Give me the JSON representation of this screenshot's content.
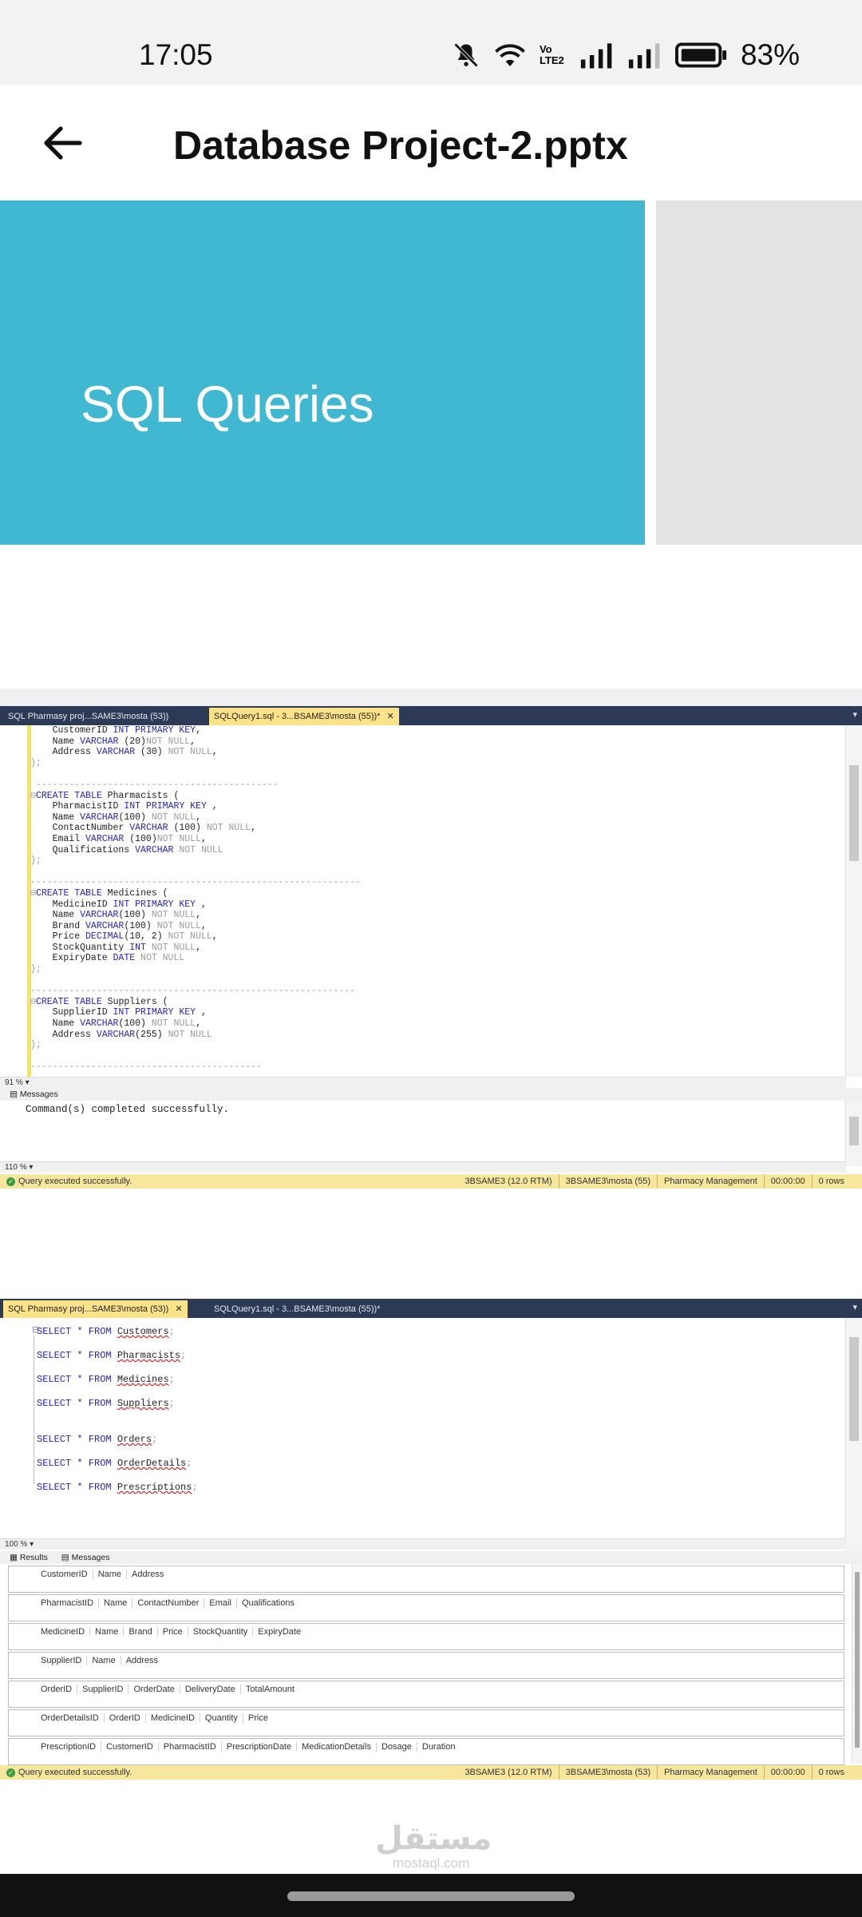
{
  "status_bar": {
    "time": "17:05",
    "volte": "Vo LTE2",
    "battery_percent": "83%"
  },
  "app_bar": {
    "title": "Database Project-2.pptx"
  },
  "slide1": {
    "title": "SQL Queries"
  },
  "ssms1": {
    "tab_inactive": "SQL Pharmasy proj...SAME3\\mosta (53))",
    "tab_active": "SQLQuery1.sql - 3...BSAME3\\mosta (55))*",
    "editor_zoom": "91 %",
    "messages_tab": "Messages",
    "message": "Command(s) completed successfully.",
    "messages_zoom": "110 %",
    "status_text": "Query executed successfully.",
    "status_server": "3BSAME3 (12.0 RTM)",
    "status_user": "3BSAME3\\mosta (55)",
    "status_db": "Pharmacy Management",
    "status_time": "00:00:00",
    "status_rows": "0 rows"
  },
  "ssms2": {
    "tab_active": "SQL Pharmasy proj...SAME3\\mosta (53))",
    "tab_inactive": "SQLQuery1.sql - 3...BSAME3\\mosta (55))*",
    "editor_zoom": "100 %",
    "results_tab": "Results",
    "messages_tab": "Messages",
    "queries": [
      {
        "kw": "SELECT * FROM",
        "table": "Customers"
      },
      {
        "kw": "SELECT * FROM",
        "table": "Pharmacists"
      },
      {
        "kw": "SELECT * FROM",
        "table": "Medicines"
      },
      {
        "kw": "SELECT * FROM",
        "table": "Suppliers"
      },
      {
        "kw": "SELECT * FROM",
        "table": "Orders"
      },
      {
        "kw": "SELECT * FROM",
        "table": "OrderDetails"
      },
      {
        "kw": "SELECT * FROM",
        "table": "Prescriptions"
      }
    ],
    "result_grids": [
      [
        "CustomerID",
        "Name",
        "Address"
      ],
      [
        "PharmacistID",
        "Name",
        "ContactNumber",
        "Email",
        "Qualifications"
      ],
      [
        "MedicineID",
        "Name",
        "Brand",
        "Price",
        "StockQuantity",
        "ExpiryDate"
      ],
      [
        "SupplierID",
        "Name",
        "Address"
      ],
      [
        "OrderID",
        "SupplierID",
        "OrderDate",
        "DeliveryDate",
        "TotalAmount"
      ],
      [
        "OrderDetailsID",
        "OrderID",
        "MedicineID",
        "Quantity",
        "Price"
      ],
      [
        "PrescriptionID",
        "CustomerID",
        "PharmacistID",
        "PrescriptionDate",
        "MedicationDetails",
        "Dosage",
        "Duration"
      ]
    ],
    "status_text": "Query executed successfully.",
    "status_server": "3BSAME3 (12.0 RTM)",
    "status_user": "3BSAME3\\mosta (53)",
    "status_db": "Pharmacy Management",
    "status_time": "00:00:00",
    "status_rows": "0 rows"
  },
  "watermark": {
    "arabic": "مستقل",
    "latin": "mostaql.com"
  },
  "icons": [
    "mute-bell-icon",
    "wifi-icon",
    "signal-icon",
    "battery-icon",
    "back-arrow-icon",
    "close-icon",
    "success-icon"
  ]
}
